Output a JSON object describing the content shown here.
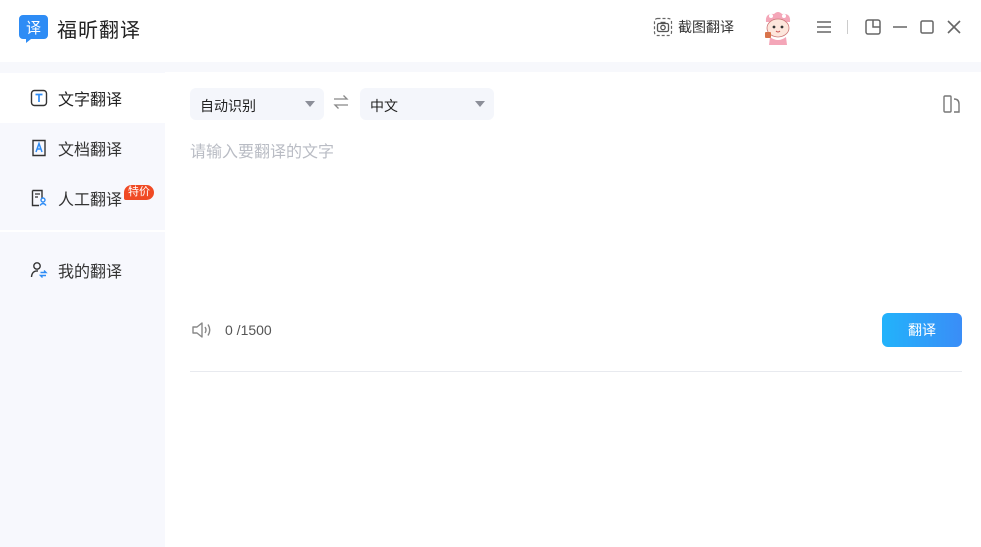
{
  "app": {
    "name": "福昕翻译",
    "logo_glyph": "译",
    "accent_color": "#2e8cf5"
  },
  "titlebar": {
    "screenshot_label": "截图翻译",
    "icons": [
      "camera-icon",
      "avatar",
      "menu-icon",
      "pin-icon",
      "minimize-icon",
      "maximize-icon",
      "close-icon"
    ]
  },
  "sidebar": {
    "items": [
      {
        "label": "文字翻译",
        "icon": "text-translate-icon",
        "active": true
      },
      {
        "label": "文档翻译",
        "icon": "document-translate-icon",
        "active": false
      },
      {
        "label": "人工翻译",
        "icon": "human-translate-icon",
        "active": false,
        "badge": "特价",
        "badge_color": "#f04a24"
      },
      {
        "label": "我的翻译",
        "icon": "my-translate-icon",
        "active": false
      }
    ]
  },
  "main": {
    "source_lang": "自动识别",
    "target_lang": "中文",
    "input_placeholder": "请输入要翻译的文字",
    "input_value": "",
    "char_count": "0 /1500",
    "translate_label": "翻译",
    "button_color": "#2ea4f8"
  }
}
